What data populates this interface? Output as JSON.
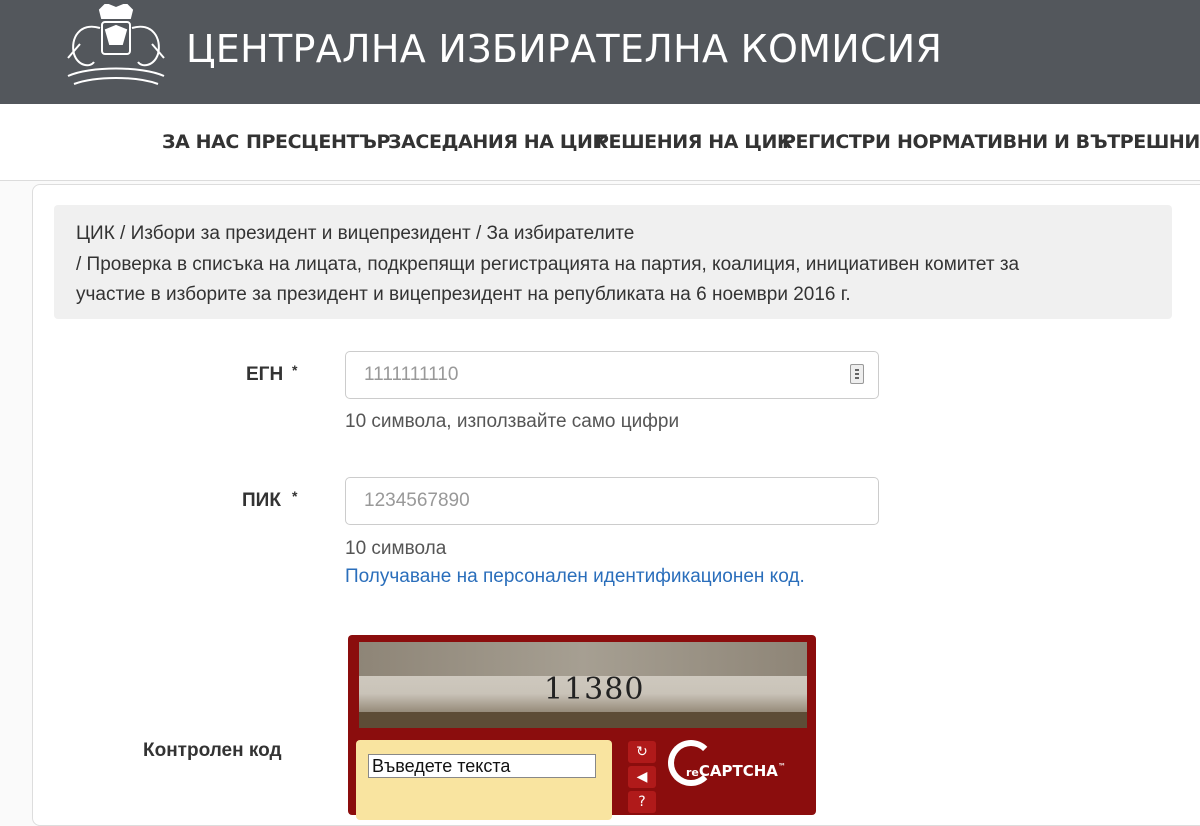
{
  "header": {
    "site_title": "ЦЕНТРАЛНА ИЗБИРАТЕЛНА КОМИСИЯ",
    "logo_icon": "coat-of-arms-icon"
  },
  "nav": {
    "items": [
      {
        "label": "ЗА НАС"
      },
      {
        "label": "ПРЕСЦЕНТЪР"
      },
      {
        "label": "ЗАСЕДАНИЯ НА ЦИК"
      },
      {
        "label": "РЕШЕНИЯ НА ЦИК"
      },
      {
        "label": "РЕГИСТРИ"
      },
      {
        "label": "НОРМАТИВНИ И ВЪТРЕШНИ АКТОВЕ"
      }
    ]
  },
  "breadcrumb": {
    "line1": "ЦИК /  Избори за президент и вицепрезидент /  За избирателите",
    "line2": " /  Проверка в списъка на лицата, подкрепящи регистрацията на партия, коалиция, инициативен комитет за",
    "line3": "участие в изборите за президент и вицепрезидент на републиката на 6 ноември 2016 г."
  },
  "form": {
    "egn": {
      "label": "ЕГН",
      "required_mark": "*",
      "placeholder": "1111111110",
      "help": "10 символа, използвайте само цифри"
    },
    "pik": {
      "label": "ПИК",
      "required_mark": "*",
      "placeholder": "1234567890",
      "help": "10 символа",
      "link": "Получаване на персонален идентификационен код."
    },
    "captcha": {
      "label": "Контролен код",
      "image_word": "11380",
      "input_value": "Въведете текста",
      "brand_re": "re",
      "brand_name": "CAPTCHA",
      "brand_tm": "™"
    }
  },
  "colors": {
    "header_bg": "#53575c",
    "captcha_red": "#8b0d0d",
    "link_blue": "#2a6ebb"
  }
}
